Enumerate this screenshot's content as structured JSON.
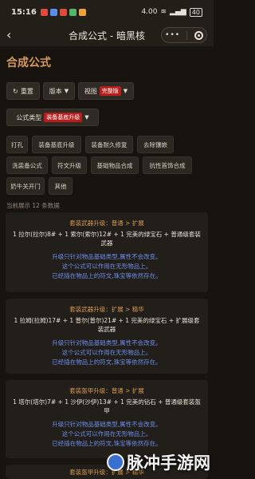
{
  "status": {
    "time": "15:16",
    "net": "4.00",
    "battery": "40",
    "app_colors": [
      "#e04a3a",
      "#5b8def",
      "#e04a3a",
      "#52b76b",
      "#f0a23a"
    ]
  },
  "nav": {
    "title": "合成公式 - 暗黑核",
    "back": "‹"
  },
  "page_title": "合成公式",
  "toolbar": {
    "reset": "重置",
    "version": "版本",
    "view": "视图",
    "view_tag": "完整版",
    "formula_type": "公式类型",
    "formula_tag": "装备基底升级"
  },
  "filters": [
    "打孔",
    "装备基底升级",
    "装备耐久修复",
    "去除镶嵌",
    "洗装备公式",
    "符文升级",
    "基础物品合成",
    "抗性首饰合成",
    "奶牛关开门",
    "其他"
  ],
  "count_text": "当前展示 12 条数据",
  "cards": [
    {
      "title": "套装武器升级：普通 > 扩展",
      "recipe": "1 拉尔(拉尔)8# + 1 索尔(索尔)12# + 1 完美的绿宝石 + 普通级套装武器",
      "desc": [
        "升级只针对物品基础类型,属性不会改变。",
        "这个公式可以作用在无形物品上。",
        "已经插在物品上的符文,珠宝等依然存在。"
      ]
    },
    {
      "title": "套装武器升级：扩展 > 精华",
      "recipe": "1 拉姆(拉姆)17# + 1 普尔(普尔)21# + 1 完美的绿宝石 + 扩展级套装武器",
      "desc": [
        "升级只针对物品基础类型,属性不会改变。",
        "这个公式可以作用在无形物品上。",
        "已经插在物品上的符文,珠宝等依然存在。"
      ]
    },
    {
      "title": "套装盔甲升级：普通 > 扩展",
      "recipe": "1 塔尔(塔尔)7# + 1 沙伊(沙伊)13# + 1 完美的钻石 + 普通级套装盔甲",
      "desc": [
        "升级只针对物品基础类型,属性不会改变。",
        "这个公式可以作用在无形物品上。",
        "已经插在物品上的符文,珠宝等依然存在。"
      ]
    },
    {
      "title": "套装盔甲升级：扩展 > 精华",
      "recipe": "",
      "desc": []
    }
  ],
  "watermark": "脉冲手游网"
}
